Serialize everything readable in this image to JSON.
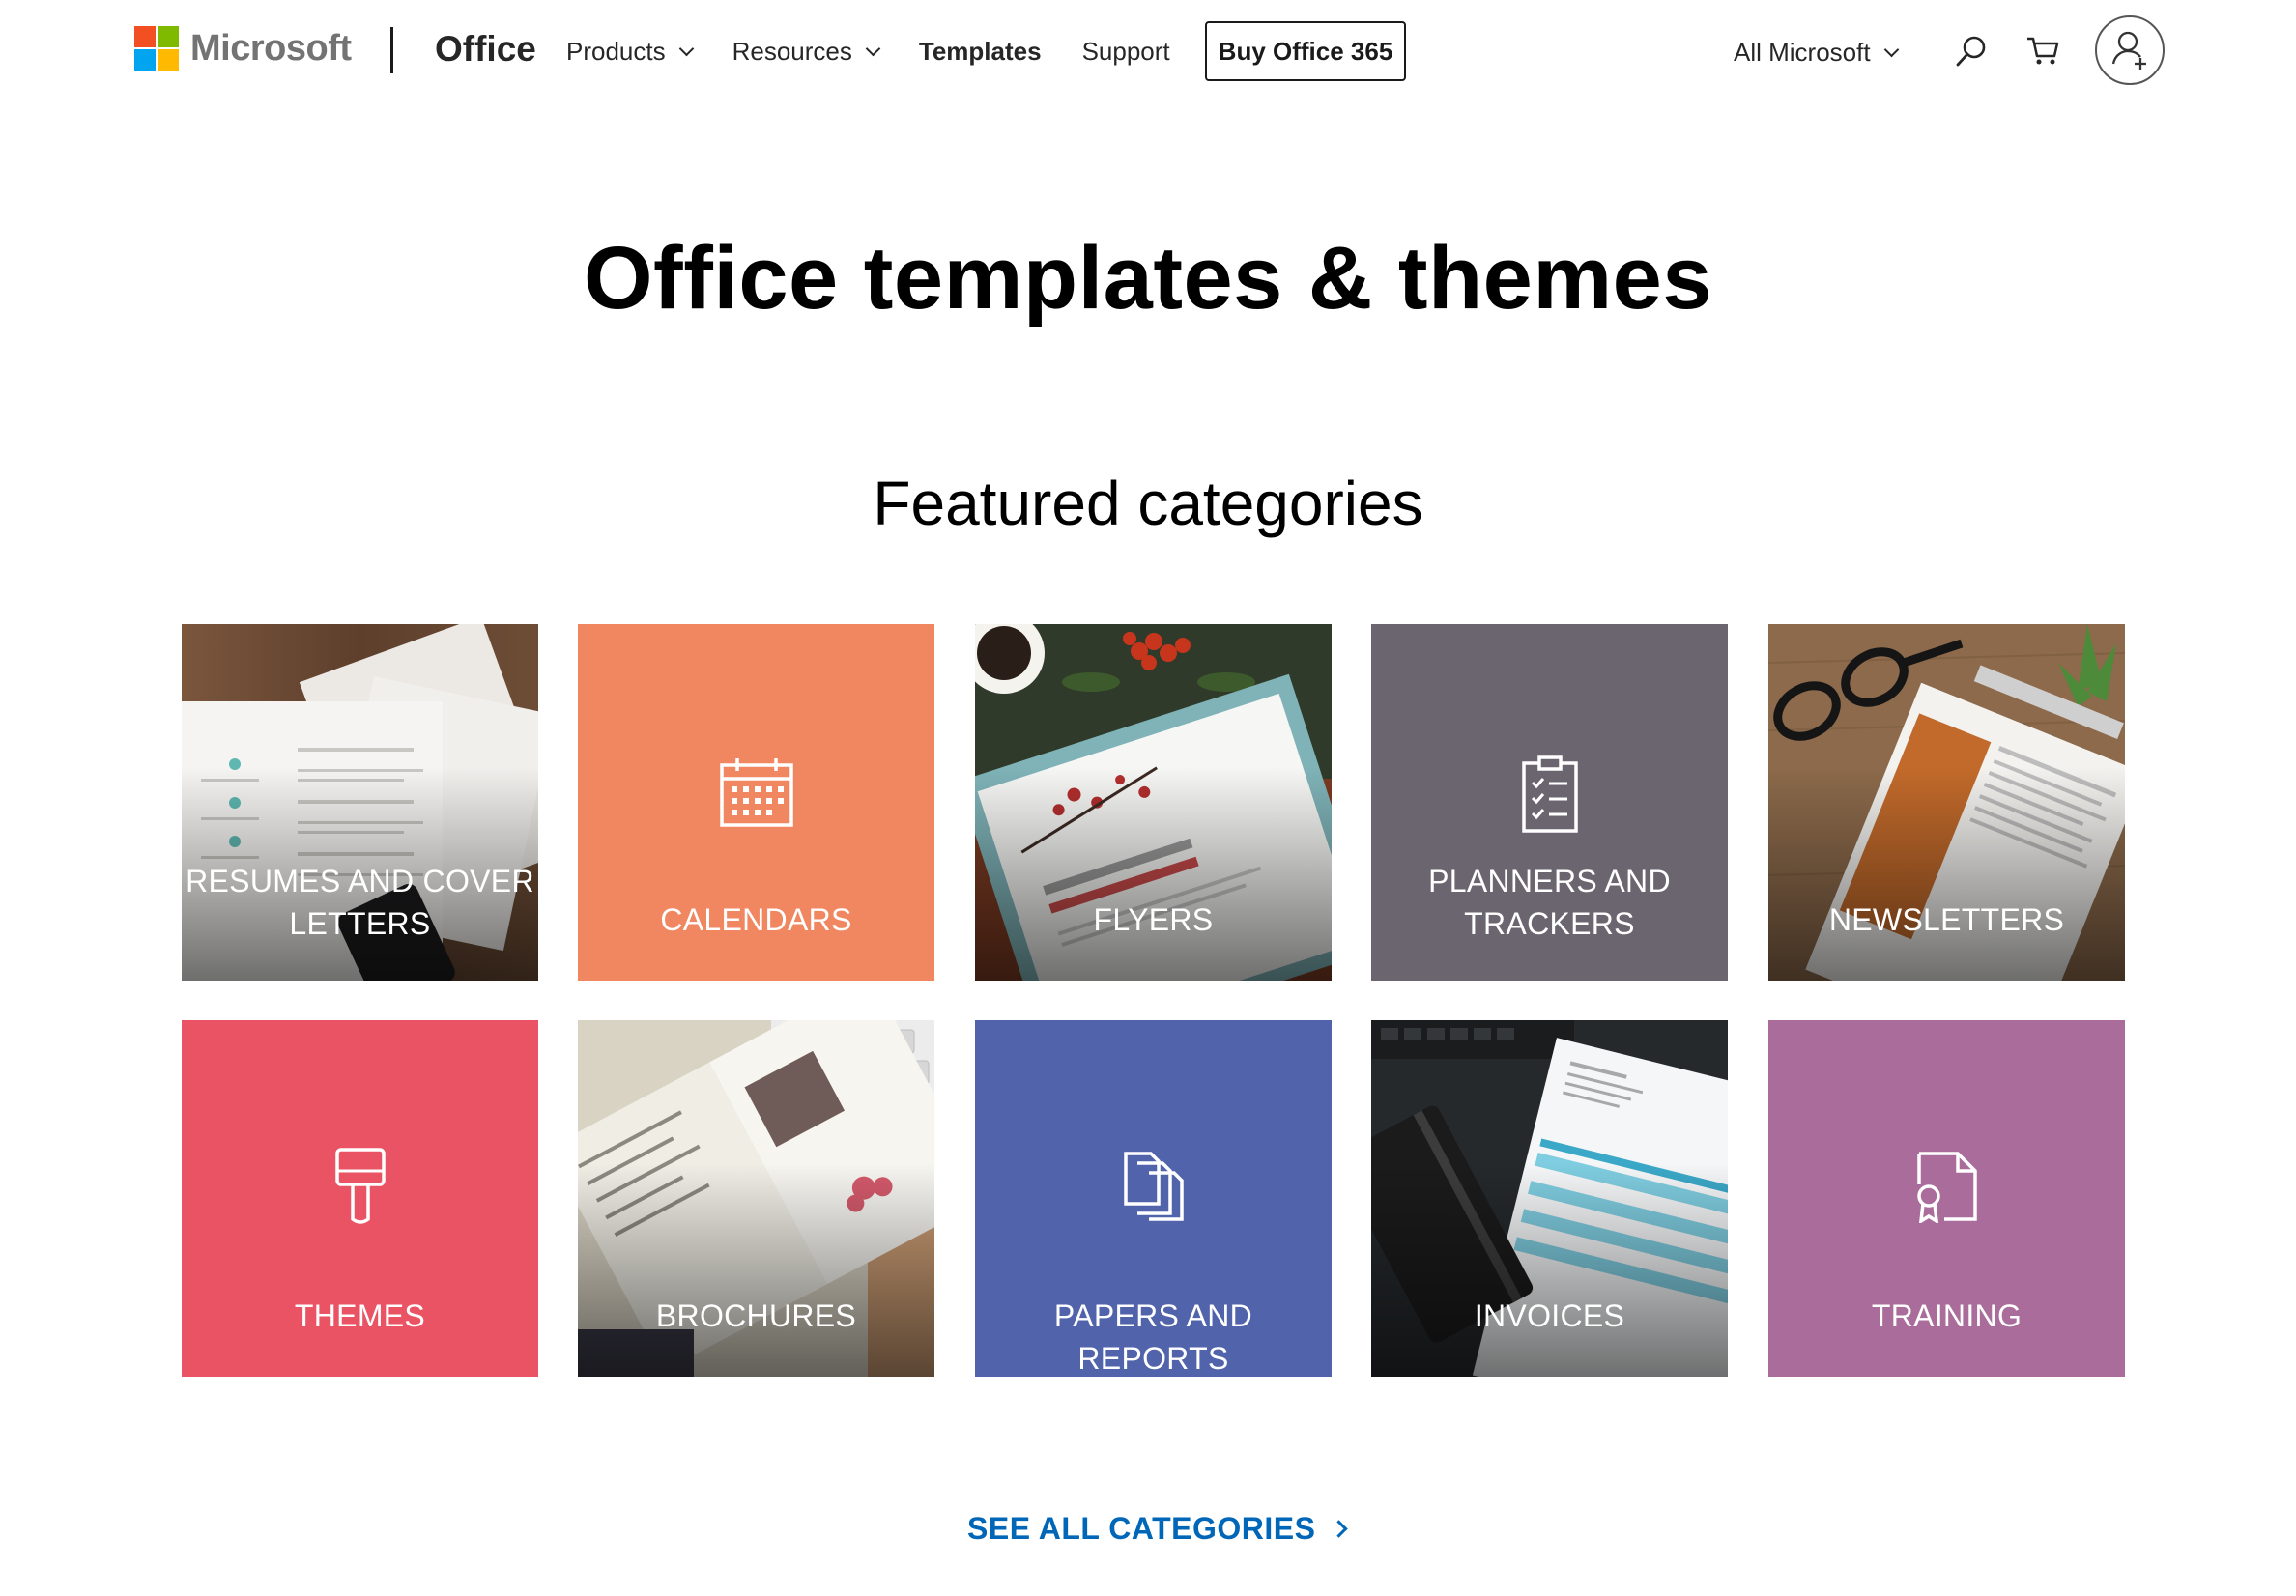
{
  "header": {
    "brand": "Microsoft",
    "office": "Office",
    "nav": [
      {
        "label": "Products",
        "dropdown": true
      },
      {
        "label": "Resources",
        "dropdown": true
      },
      {
        "label": "Templates",
        "dropdown": false,
        "active": true
      },
      {
        "label": "Support",
        "dropdown": false
      }
    ],
    "buy_button": "Buy Office 365",
    "all_microsoft": "All Microsoft",
    "icons": [
      "search-icon",
      "cart-icon",
      "account-icon"
    ]
  },
  "main": {
    "title": "Office templates & themes",
    "section_title": "Featured categories",
    "categories": [
      {
        "label_lines": [
          "RESUMES AND COVER",
          "LETTERS"
        ],
        "style": "photo",
        "color": "#6b4a33",
        "icon": "resume-photo"
      },
      {
        "label_lines": [
          "CALENDARS"
        ],
        "style": "solid",
        "color": "#f08761",
        "icon": "calendar-icon"
      },
      {
        "label_lines": [
          "FLYERS"
        ],
        "style": "photo",
        "color": "#8b3a2a",
        "icon": "flyer-photo"
      },
      {
        "label_lines": [
          "PLANNERS AND",
          "TRACKERS"
        ],
        "style": "solid",
        "color": "#6b6570",
        "icon": "checklist-icon"
      },
      {
        "label_lines": [
          "NEWSLETTERS"
        ],
        "style": "photo",
        "color": "#9a7452",
        "icon": "newsletter-photo"
      },
      {
        "label_lines": [
          "THEMES"
        ],
        "style": "solid",
        "color": "#ea5363",
        "icon": "paintbrush-icon"
      },
      {
        "label_lines": [
          "BROCHURES"
        ],
        "style": "photo",
        "color": "#c9c2b0",
        "icon": "brochure-photo"
      },
      {
        "label_lines": [
          "PAPERS AND REPORTS"
        ],
        "style": "solid",
        "color": "#5163ab",
        "icon": "documents-icon"
      },
      {
        "label_lines": [
          "INVOICES"
        ],
        "style": "photo",
        "color": "#2a2d30",
        "icon": "invoice-photo"
      },
      {
        "label_lines": [
          "TRAINING"
        ],
        "style": "solid",
        "color": "#a96c9b",
        "icon": "certificate-icon"
      }
    ],
    "see_all": "SEE ALL CATEGORIES"
  },
  "colors": {
    "link_blue": "#0067b8",
    "ms_red": "#f25022",
    "ms_green": "#7fba00",
    "ms_blue": "#00a4ef",
    "ms_yellow": "#ffb900"
  }
}
